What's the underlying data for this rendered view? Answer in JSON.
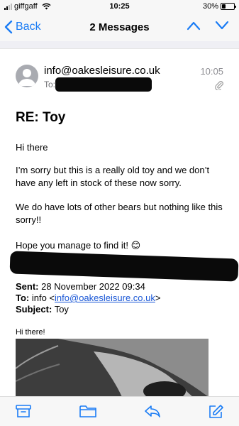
{
  "status_bar": {
    "carrier": "giffgaff",
    "time": "10:25",
    "battery": "30%",
    "battery_level": 0.3
  },
  "nav": {
    "back_label": "Back",
    "title": "2 Messages"
  },
  "message": {
    "from": "info@oakesleisure.co.uk",
    "time": "10:05",
    "to_label": "To:",
    "subject": "RE: Toy",
    "greeting": "Hi there",
    "paragraph1": "I’m sorry but this is a really old toy and we don’t have any left in stock of these now sorry.",
    "paragraph2": "We do have lots of other bears but nothing like this sorry!!",
    "paragraph3": "Hope you manage to find it! 😊"
  },
  "quoted": {
    "sent_label": "Sent:",
    "sent_value": "28 November 2022 09:34",
    "to_label": "To:",
    "to_prefix": "info <",
    "to_link": "info@oakesleisure.co.uk",
    "to_suffix": ">",
    "subject_label": "Subject:",
    "subject_value": "Toy",
    "greeting": "Hi there!"
  },
  "toolbar": {
    "icons": [
      "archive-icon",
      "folder-icon",
      "reply-icon",
      "compose-icon"
    ]
  },
  "colors": {
    "accent": "#1a7cf5",
    "link": "#1a57d6",
    "toolbar_bg": "#f7f7f7"
  }
}
